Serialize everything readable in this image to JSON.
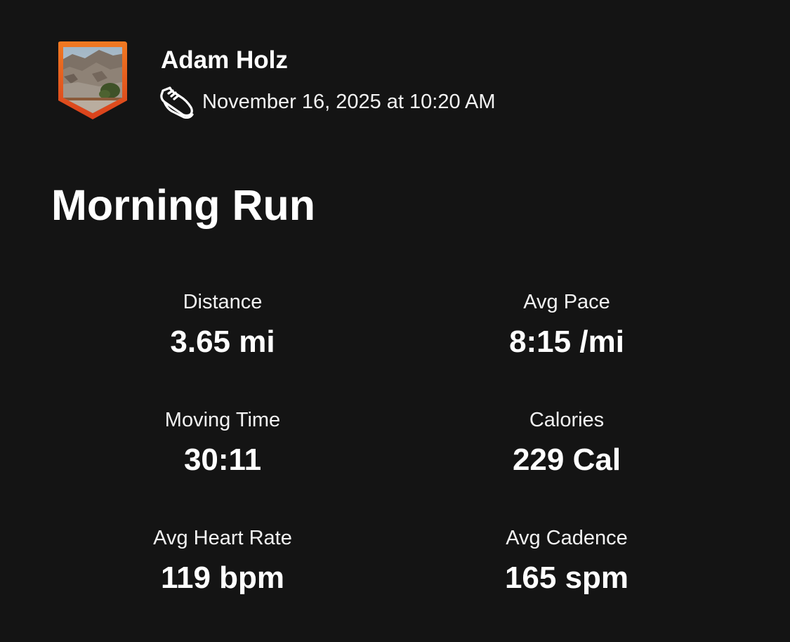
{
  "athlete": {
    "name": "Adam Holz",
    "avatar_icon": "mountain-landscape-shield-avatar",
    "avatar_border_color": "#e8501a"
  },
  "activity": {
    "sport_icon": "running-shoe-icon",
    "date": "November 16, 2025 at 10:20 AM",
    "title": "Morning Run"
  },
  "stats": [
    {
      "label": "Distance",
      "value": "3.65 mi"
    },
    {
      "label": "Avg Pace",
      "value": "8:15 /mi"
    },
    {
      "label": "Moving Time",
      "value": "30:11"
    },
    {
      "label": "Calories",
      "value": "229 Cal"
    },
    {
      "label": "Avg Heart Rate",
      "value": "119 bpm"
    },
    {
      "label": "Avg Cadence",
      "value": "165 spm"
    }
  ]
}
